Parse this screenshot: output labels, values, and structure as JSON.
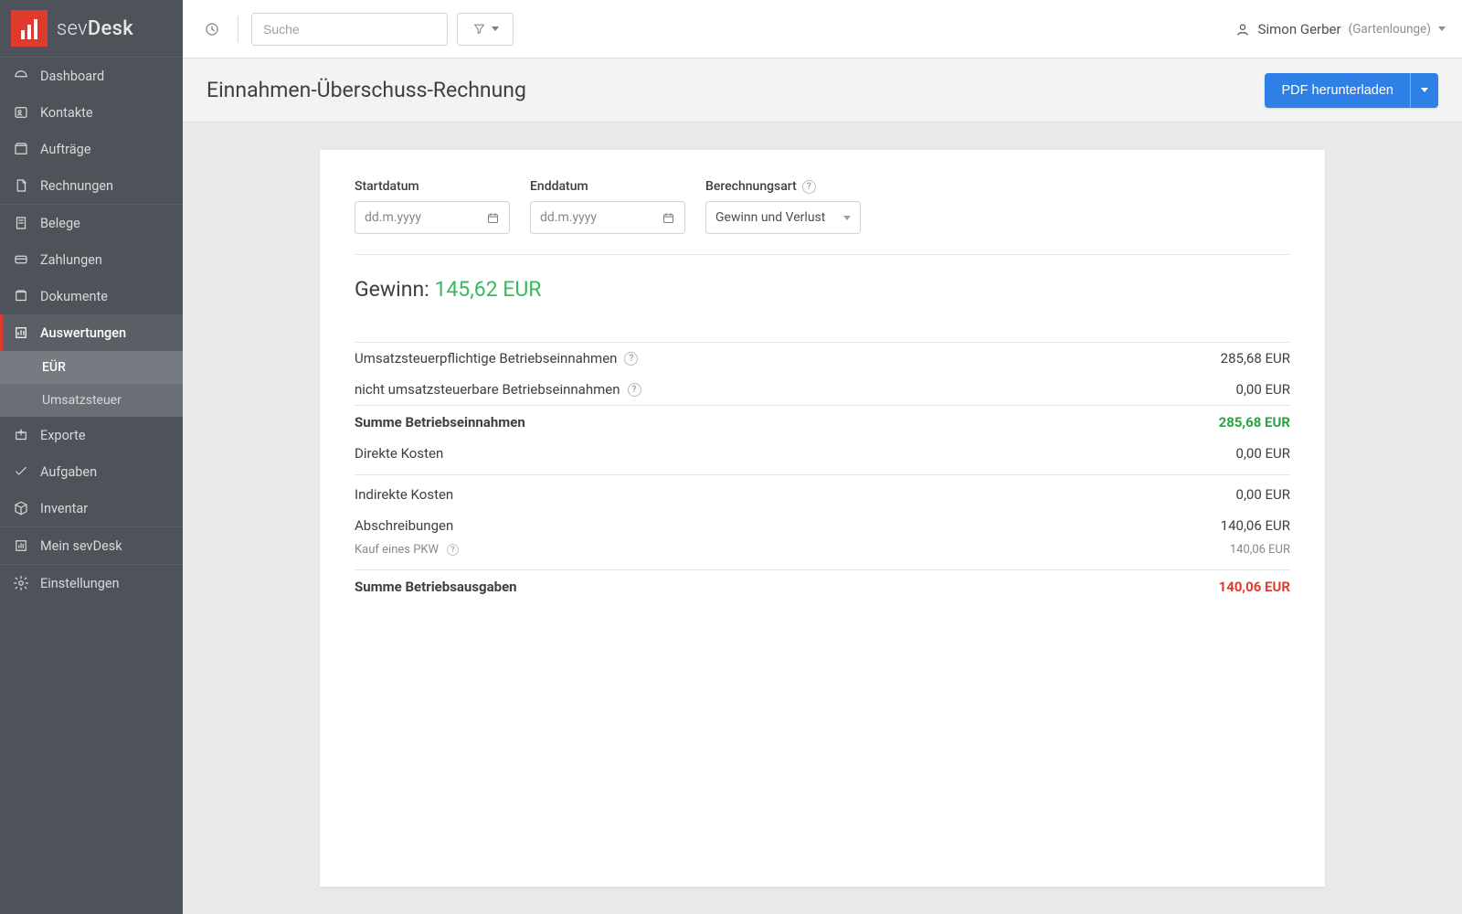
{
  "brand": {
    "name": "sevDesk"
  },
  "header": {
    "search_placeholder": "Suche",
    "user_name": "Simon Gerber",
    "company_name": "(Gartenlounge)"
  },
  "sidebar": {
    "group1": [
      {
        "label": "Dashboard"
      },
      {
        "label": "Kontakte"
      },
      {
        "label": "Aufträge"
      },
      {
        "label": "Rechnungen"
      }
    ],
    "group2": [
      {
        "label": "Belege"
      },
      {
        "label": "Zahlungen"
      },
      {
        "label": "Dokumente"
      },
      {
        "label": "Auswertungen",
        "active": true,
        "children": [
          {
            "label": "EÜR",
            "active": true
          },
          {
            "label": "Umsatzsteuer"
          }
        ]
      },
      {
        "label": "Exporte"
      },
      {
        "label": "Aufgaben"
      },
      {
        "label": "Inventar"
      }
    ],
    "group3": [
      {
        "label": "Mein sevDesk"
      }
    ],
    "group4": [
      {
        "label": "Einstellungen"
      }
    ]
  },
  "page": {
    "title": "Einnahmen-Überschuss-Rechnung",
    "download_label": "PDF herunterladen"
  },
  "filters": {
    "start_label": "Startdatum",
    "end_label": "Enddatum",
    "calc_label": "Berechnungsart",
    "date_placeholder": "dd.m.yyyy",
    "calc_value": "Gewinn und Verlust"
  },
  "profit": {
    "label": "Gewinn:",
    "value": "145,62 EUR"
  },
  "report": {
    "rows": [
      {
        "label": "Umsatzsteuerpflichtige Betriebseinnahmen",
        "help": true,
        "value": "285,68 EUR"
      },
      {
        "label": "nicht umsatzsteuerbare Betriebseinnahmen",
        "help": true,
        "value": "0,00 EUR"
      }
    ],
    "sum_income": {
      "label": "Summe Betriebseinnahmen",
      "value": "285,68 EUR"
    },
    "direct_cost": {
      "label": "Direkte Kosten",
      "value": "0,00 EUR"
    },
    "indirect_cost": {
      "label": "Indirekte Kosten",
      "value": "0,00 EUR"
    },
    "depreciation": {
      "label": "Abschreibungen",
      "value": "140,06 EUR"
    },
    "depreciation_sub": {
      "label": "Kauf eines PKW",
      "help": true,
      "value": "140,06 EUR"
    },
    "sum_expense": {
      "label": "Summe Betriebsausgaben",
      "value": "140,06 EUR"
    }
  }
}
